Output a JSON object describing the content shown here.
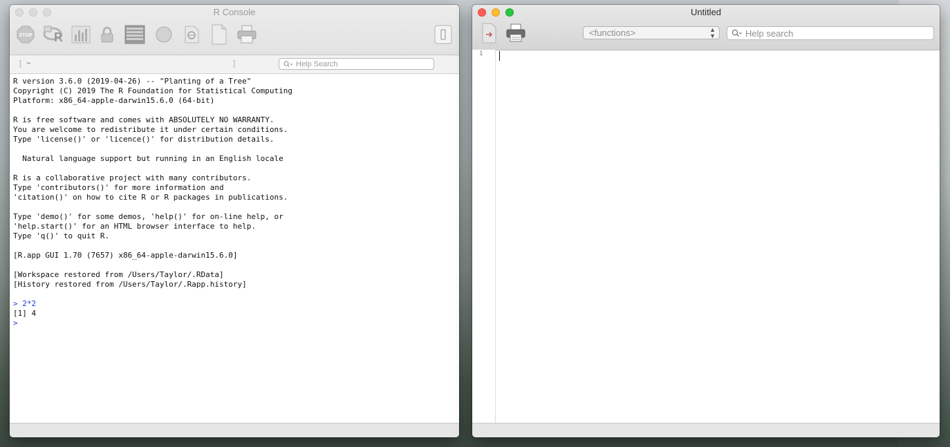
{
  "console": {
    "title": "R Console",
    "path": "~",
    "help_search_placeholder": "Help Search",
    "stop_label": "STOP",
    "lines": [
      "R version 3.6.0 (2019-04-26) -- \"Planting of a Tree\"",
      "Copyright (C) 2019 The R Foundation for Statistical Computing",
      "Platform: x86_64-apple-darwin15.6.0 (64-bit)",
      "",
      "R is free software and comes with ABSOLUTELY NO WARRANTY.",
      "You are welcome to redistribute it under certain conditions.",
      "Type 'license()' or 'licence()' for distribution details.",
      "",
      "  Natural language support but running in an English locale",
      "",
      "R is a collaborative project with many contributors.",
      "Type 'contributors()' for more information and",
      "'citation()' on how to cite R or R packages in publications.",
      "",
      "Type 'demo()' for some demos, 'help()' for on-line help, or",
      "'help.start()' for an HTML browser interface to help.",
      "Type 'q()' to quit R.",
      "",
      "[R.app GUI 1.70 (7657) x86_64-apple-darwin15.6.0]",
      "",
      "[Workspace restored from /Users/Taylor/.RData]",
      "[History restored from /Users/Taylor/.Rapp.history]",
      ""
    ],
    "input_line": "> 2*2",
    "output_line": "[1] 4",
    "prompt": ">"
  },
  "editor": {
    "title": "Untitled",
    "functions_placeholder": "<functions>",
    "help_search_placeholder": "Help search",
    "line_number": "1"
  },
  "colors": {
    "console_input": "#1b3ad6",
    "close": "#fc5f57",
    "minimize": "#fdbc2e",
    "maximize": "#29c840"
  }
}
